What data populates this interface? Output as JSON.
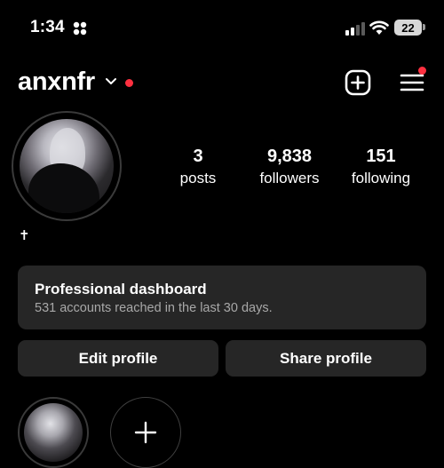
{
  "status_bar": {
    "time": "1:34",
    "focus_icon": "focus-mode-icon",
    "battery": "22"
  },
  "header": {
    "username": "anxnfr",
    "dropdown_icon": "chevron-down-icon",
    "new_post_icon": "plus-square-icon",
    "menu_icon": "hamburger-menu-icon",
    "accent_color": "#ff3040"
  },
  "profile": {
    "stats": [
      {
        "value": "3",
        "label": "posts"
      },
      {
        "value": "9,838",
        "label": "followers"
      },
      {
        "value": "151",
        "label": "following"
      }
    ],
    "bio": "✝"
  },
  "dashboard": {
    "title": "Professional dashboard",
    "subtitle": "531 accounts reached in the last 30 days."
  },
  "actions": {
    "edit_label": "Edit profile",
    "share_label": "Share profile"
  },
  "highlights": {
    "new_icon": "plus-icon"
  }
}
